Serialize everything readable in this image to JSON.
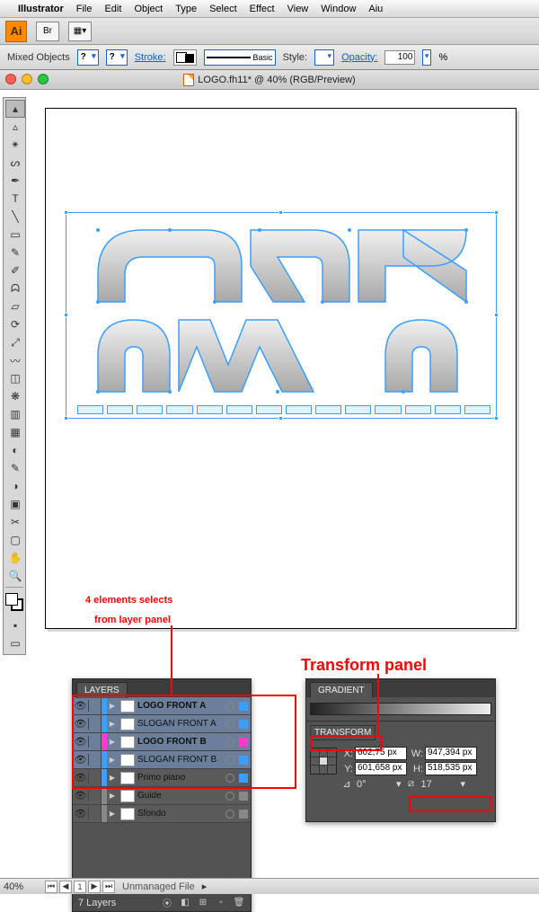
{
  "menu": {
    "items": [
      "Illustrator",
      "File",
      "Edit",
      "Object",
      "Type",
      "Select",
      "Effect",
      "View",
      "Window",
      "Aiu"
    ]
  },
  "controlbar": {
    "selection": "Mixed Objects",
    "stroke_label": "Stroke:",
    "style_label": "Style:",
    "basic_label": "Basic",
    "opacity_label": "Opacity:",
    "opacity_value": "100",
    "percent": "%"
  },
  "doc": {
    "title": "LOGO.fh11* @ 40% (RGB/Preview)"
  },
  "annotations": {
    "a1_l1": "4 elements selects",
    "a1_l2": "from layer panel",
    "a2": "Transform panel"
  },
  "layers": {
    "tab": "LAYERS",
    "rows": [
      {
        "name": "LOGO FRONT A",
        "bold": true,
        "sel": true,
        "color": "#3aa0ff",
        "sq": "#3aa0ff"
      },
      {
        "name": "SLOGAN FRONT A",
        "bold": false,
        "sel": true,
        "color": "#3aa0ff",
        "sq": "#3aa0ff"
      },
      {
        "name": "LOGO FRONT B",
        "bold": true,
        "sel": true,
        "color": "#ff3ad0",
        "sq": "#ff3ad0"
      },
      {
        "name": "SLOGAN FRONT B",
        "bold": false,
        "sel": true,
        "color": "#3aa0ff",
        "sq": "#3aa0ff"
      },
      {
        "name": "Primo piano",
        "bold": false,
        "sel": false,
        "color": "#3aa0ff",
        "sq": "#3aa0ff"
      },
      {
        "name": "Guide",
        "bold": false,
        "sel": false,
        "color": "#888",
        "sq": "#888"
      },
      {
        "name": "Sfondo",
        "bold": false,
        "sel": false,
        "color": "#888",
        "sq": "#888"
      }
    ],
    "footer": "7 Layers"
  },
  "gradient": {
    "tab": "GRADIENT"
  },
  "transform": {
    "tab": "TRANSFORM",
    "x_label": "X:",
    "x_value": "602,75 px",
    "y_label": "Y:",
    "y_value": "601,658 px",
    "w_label": "W:",
    "w_value": "947,394 px",
    "h_label": "H:",
    "h_value": "518,535 px",
    "angle_label": "⊿:",
    "angle_value": "0°",
    "shear_value": "17"
  },
  "status": {
    "zoom": "40%",
    "page": "1",
    "unmanaged": "Unmanaged File"
  }
}
